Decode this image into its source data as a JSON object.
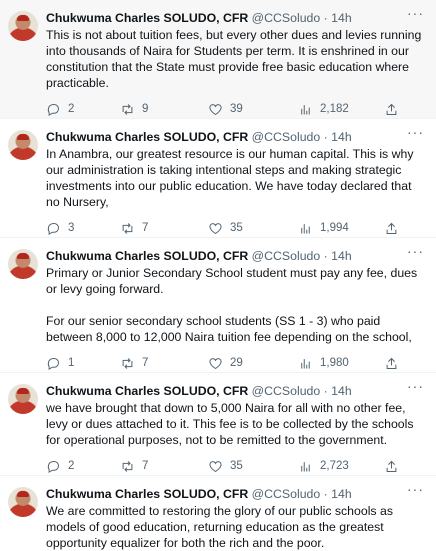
{
  "tweets": [
    {
      "name": "Chukwuma Charles SOLUDO, CFR",
      "handle": "@CCSoludo",
      "time": "14h",
      "paragraphs": [
        "This is not about tuition fees, but every other dues and levies running into thousands of Naira for Students per term. It is enshrined in our constitution that the State must provide free basic education where practicable."
      ],
      "replies": "2",
      "retweets": "9",
      "likes": "39",
      "views": "2,182"
    },
    {
      "name": "Chukwuma Charles SOLUDO, CFR",
      "handle": "@CCSoludo",
      "time": "14h",
      "paragraphs": [
        "In Anambra, our greatest resource is our human capital. This is why our administration is taking intentional steps and making strategic investments into our public education. We have today declared that no Nursery,"
      ],
      "replies": "3",
      "retweets": "7",
      "likes": "35",
      "views": "1,994"
    },
    {
      "name": "Chukwuma Charles SOLUDO, CFR",
      "handle": "@CCSoludo",
      "time": "14h",
      "paragraphs": [
        "Primary or Junior Secondary School student must pay any fee, dues or levy going forward.",
        "For our senior secondary school students (SS 1 - 3) who paid between 8,000 to 12,000 Naira tuition fee depending on the school,"
      ],
      "replies": "1",
      "retweets": "7",
      "likes": "29",
      "views": "1,980"
    },
    {
      "name": "Chukwuma Charles SOLUDO, CFR",
      "handle": "@CCSoludo",
      "time": "14h",
      "paragraphs": [
        "we have brought that down to 5,000 Naira for all with no other fee, levy or dues attached to it. This fee is to be collected by the schools for operational purposes, not to be remitted to the government."
      ],
      "replies": "2",
      "retweets": "7",
      "likes": "35",
      "views": "2,723"
    },
    {
      "name": "Chukwuma Charles SOLUDO, CFR",
      "handle": "@CCSoludo",
      "time": "14h",
      "paragraphs": [
        "We are committed to restoring the glory of our public schools as models of good education, returning education as the greatest opportunity equalizer for both the rich and the poor."
      ],
      "replies": "",
      "retweets": "",
      "likes": "",
      "views": ""
    }
  ]
}
